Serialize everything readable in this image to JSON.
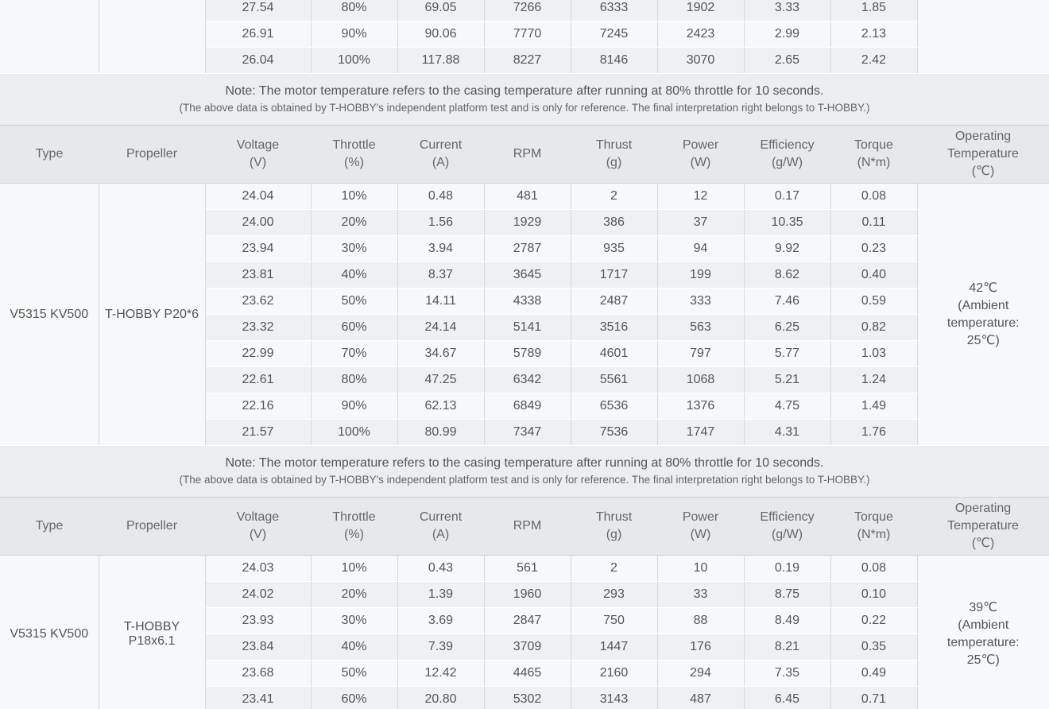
{
  "headers": {
    "type": "Type",
    "propeller": "Propeller",
    "voltage": [
      "Voltage",
      "(V)"
    ],
    "throttle": [
      "Throttle",
      "(%)"
    ],
    "current": [
      "Current",
      "(A)"
    ],
    "rpm": "RPM",
    "thrust": [
      "Thrust",
      "(g)"
    ],
    "power": [
      "Power",
      "(W)"
    ],
    "efficiency": [
      "Efficiency",
      "(g/W)"
    ],
    "torque": [
      "Torque",
      "(N*m)"
    ],
    "temperature": [
      "Operating",
      "Temperature",
      "(℃)"
    ]
  },
  "note": {
    "main": "Note: The motor temperature refers to the casing temperature after running at 80% throttle for 10 seconds.",
    "sub": "(The above data is obtained by T-HOBBY's independent platform test and is only for reference. The final interpretation right belongs to T-HOBBY.)"
  },
  "top_section": {
    "rows": [
      [
        "27.54",
        "80%",
        "69.05",
        "7266",
        "6333",
        "1902",
        "3.33",
        "1.85"
      ],
      [
        "26.91",
        "90%",
        "90.06",
        "7770",
        "7245",
        "2423",
        "2.99",
        "2.13"
      ],
      [
        "26.04",
        "100%",
        "117.88",
        "8227",
        "8146",
        "3070",
        "2.65",
        "2.42"
      ]
    ]
  },
  "section_a": {
    "type": "V5315 KV500",
    "propeller": "T-HOBBY P20*6",
    "temperature": [
      "42℃",
      "(Ambient",
      "temperature:",
      "25℃)"
    ],
    "rows": [
      [
        "24.04",
        "10%",
        "0.48",
        "481",
        "2",
        "12",
        "0.17",
        "0.08"
      ],
      [
        "24.00",
        "20%",
        "1.56",
        "1929",
        "386",
        "37",
        "10.35",
        "0.11"
      ],
      [
        "23.94",
        "30%",
        "3.94",
        "2787",
        "935",
        "94",
        "9.92",
        "0.23"
      ],
      [
        "23.81",
        "40%",
        "8.37",
        "3645",
        "1717",
        "199",
        "8.62",
        "0.40"
      ],
      [
        "23.62",
        "50%",
        "14.11",
        "4338",
        "2487",
        "333",
        "7.46",
        "0.59"
      ],
      [
        "23.32",
        "60%",
        "24.14",
        "5141",
        "3516",
        "563",
        "6.25",
        "0.82"
      ],
      [
        "22.99",
        "70%",
        "34.67",
        "5789",
        "4601",
        "797",
        "5.77",
        "1.03"
      ],
      [
        "22.61",
        "80%",
        "47.25",
        "6342",
        "5561",
        "1068",
        "5.21",
        "1.24"
      ],
      [
        "22.16",
        "90%",
        "62.13",
        "6849",
        "6536",
        "1376",
        "4.75",
        "1.49"
      ],
      [
        "21.57",
        "100%",
        "80.99",
        "7347",
        "7536",
        "1747",
        "4.31",
        "1.76"
      ]
    ]
  },
  "section_b": {
    "type": "V5315 KV500",
    "propeller": "T-HOBBY P18x6.1",
    "temperature": [
      "39℃",
      "(Ambient",
      "temperature:",
      "25℃)"
    ],
    "rows": [
      [
        "24.03",
        "10%",
        "0.43",
        "561",
        "2",
        "10",
        "0.19",
        "0.08"
      ],
      [
        "24.02",
        "20%",
        "1.39",
        "1960",
        "293",
        "33",
        "8.75",
        "0.10"
      ],
      [
        "23.93",
        "30%",
        "3.69",
        "2847",
        "750",
        "88",
        "8.49",
        "0.22"
      ],
      [
        "23.84",
        "40%",
        "7.39",
        "3709",
        "1447",
        "176",
        "8.21",
        "0.35"
      ],
      [
        "23.68",
        "50%",
        "12.42",
        "4465",
        "2160",
        "294",
        "7.35",
        "0.49"
      ],
      [
        "23.41",
        "60%",
        "20.80",
        "5302",
        "3143",
        "487",
        "6.45",
        "0.71"
      ]
    ]
  }
}
